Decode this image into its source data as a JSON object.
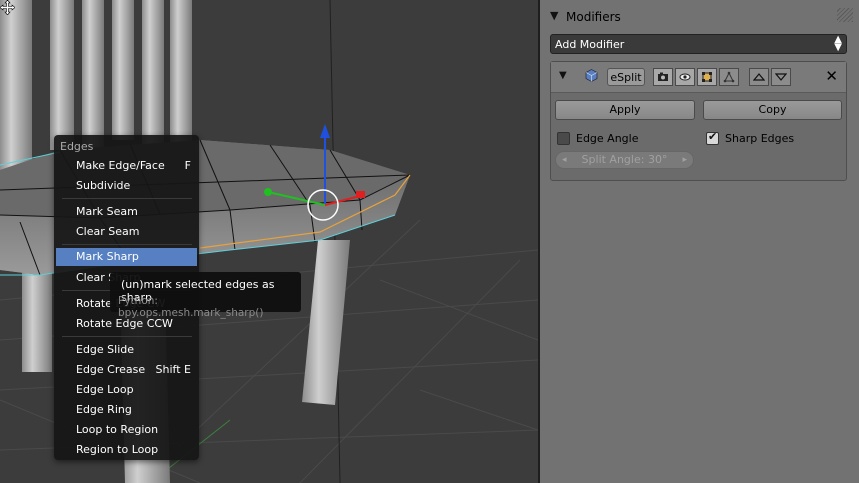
{
  "panel": {
    "title": "Modifiers",
    "add_modifier": "Add Modifier",
    "modifier": {
      "name": "eSplit",
      "apply_label": "Apply",
      "copy_label": "Copy",
      "edge_angle": {
        "label": "Edge Angle",
        "checked": false
      },
      "sharp_edges": {
        "label": "Sharp Edges",
        "checked": true
      },
      "split_angle": "Split Angle: 30°"
    }
  },
  "menu": {
    "title": "Edges",
    "items": [
      {
        "label": "Make Edge/Face",
        "shortcut": "F"
      },
      {
        "label": "Subdivide",
        "shortcut": ""
      },
      {
        "label": "Mark Seam",
        "shortcut": ""
      },
      {
        "label": "Clear Seam",
        "shortcut": ""
      },
      {
        "label": "Mark Sharp",
        "shortcut": "",
        "highlighted": true
      },
      {
        "label": "Clear Sharp",
        "shortcut": ""
      },
      {
        "label": "Rotate Edge CW",
        "shortcut": ""
      },
      {
        "label": "Rotate Edge CCW",
        "shortcut": ""
      },
      {
        "label": "Edge Slide",
        "shortcut": ""
      },
      {
        "label": "Edge Crease",
        "shortcut": "Shift E"
      },
      {
        "label": "Edge Loop",
        "shortcut": ""
      },
      {
        "label": "Edge Ring",
        "shortcut": ""
      },
      {
        "label": "Loop to Region",
        "shortcut": ""
      },
      {
        "label": "Region to Loop",
        "shortcut": ""
      }
    ]
  },
  "tooltip": {
    "description": "(un)mark selected edges as sharp",
    "python": "Python: bpy.ops.mesh.mark_sharp()"
  },
  "colors": {
    "highlight": "#5680c2",
    "selected_edge": "#e8a23a",
    "axis_x": "#e02020",
    "axis_y": "#20c020",
    "axis_z": "#2050e0"
  }
}
